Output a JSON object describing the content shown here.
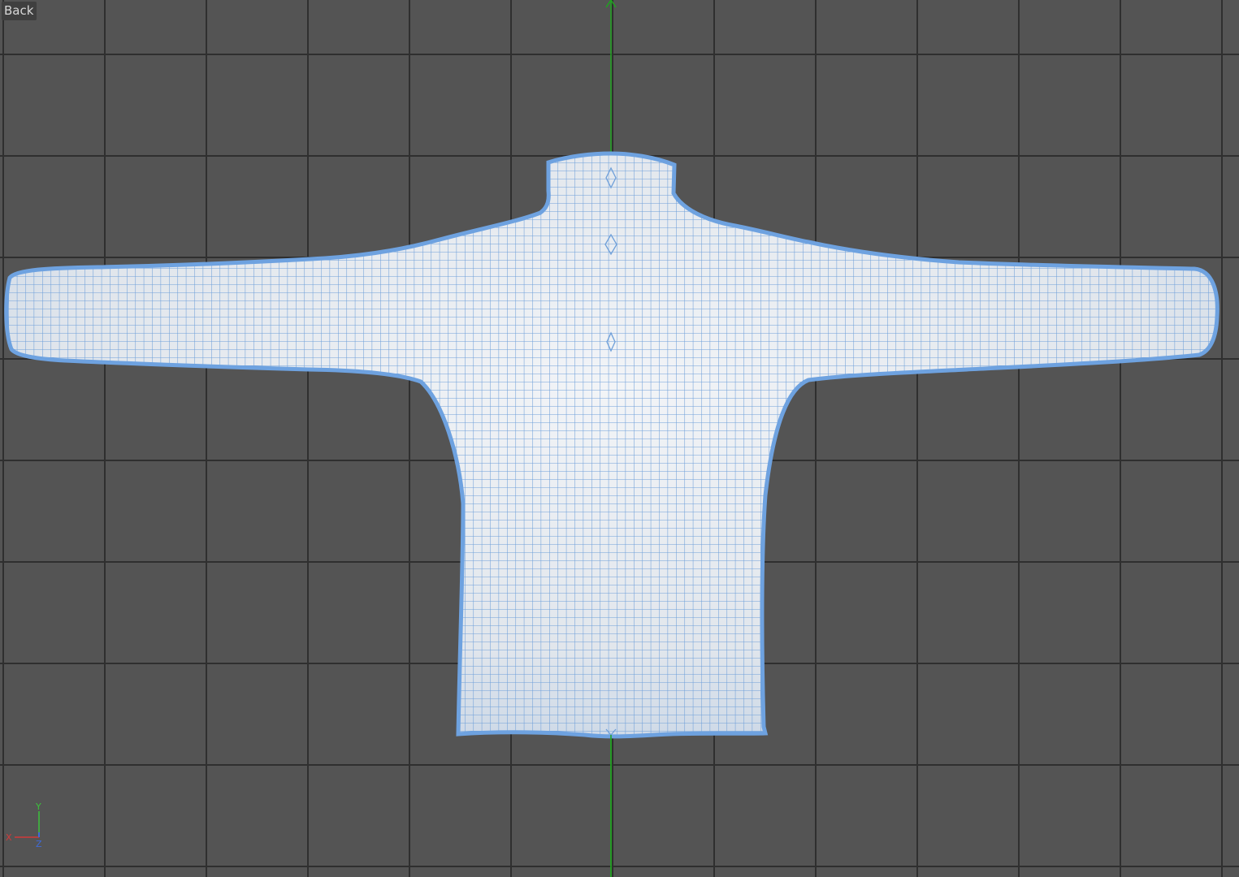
{
  "viewport": {
    "view_name": "Back",
    "background_color": "#545454",
    "grid_color": "#2f2f2f",
    "y_axis_color": "#1fa31f"
  },
  "model": {
    "surface_color": "#e8ecf1",
    "wireframe_color": "#6e9fd9",
    "silhouette_color": "#6ea2e0"
  },
  "axis_gizmo": {
    "x_label": "X",
    "y_label": "Y",
    "z_label": "Z",
    "x_color": "#d23a3a",
    "y_color": "#3bc23b",
    "z_color": "#3f6ad8"
  }
}
